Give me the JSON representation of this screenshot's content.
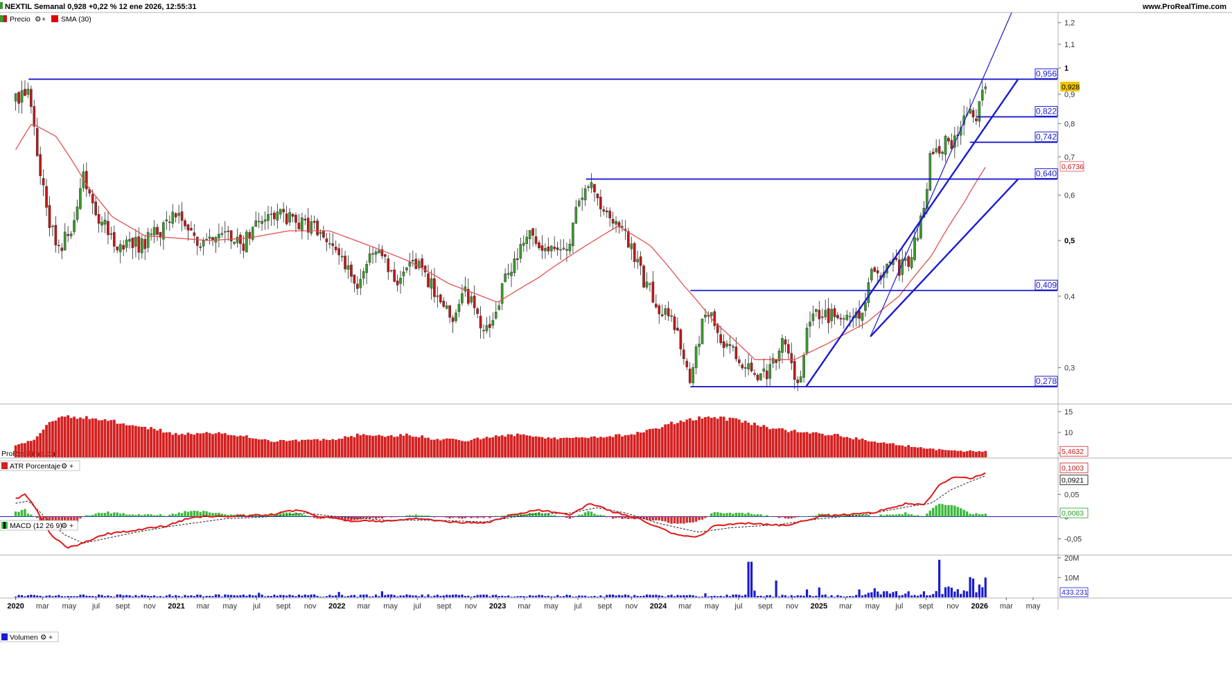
{
  "header": {
    "title": "NEXTIL Semanal 0,928 +0,22 % 12 ene 2026, 12:55:31",
    "site": "www.ProRealTime.com",
    "watermark": "ProRealTime.com"
  },
  "legends": {
    "price": "Precio",
    "sma": "SMA (30)",
    "atr": "ATR Porcentaje",
    "macd": "MACD (12 26 9)",
    "volume": "Volumen"
  },
  "colors": {
    "level_line": "#1a1ad0",
    "bull_candle": "#3c9a2e",
    "bear_candle": "#c01818",
    "sma": "#e05050",
    "atr_bar": "#d42020",
    "macd_line": "#e01818",
    "macd_hist": "#3cb83c",
    "volume_bar": "#1a1ad0",
    "current_price_bg": "#f0c400"
  },
  "chart_data": [
    {
      "type": "candlestick",
      "title": "NEXTIL Semanal",
      "y_scale": "log",
      "ylim": [
        0.26,
        1.25
      ],
      "y_ticks": [
        "0,3",
        "0,4",
        "0,5",
        "0,6",
        "0,7",
        "0,8",
        "0,9",
        "1",
        "1,1",
        "1,2"
      ],
      "x_ticks": [
        "2020",
        "mar",
        "may",
        "jul",
        "sept",
        "nov",
        "2021",
        "mar",
        "may",
        "jul",
        "sept",
        "nov",
        "2022",
        "mar",
        "may",
        "jul",
        "sept",
        "nov",
        "2023",
        "mar",
        "may",
        "jul",
        "sept",
        "nov",
        "2024",
        "mar",
        "may",
        "jul",
        "sept",
        "nov",
        "2025",
        "mar",
        "may",
        "jul",
        "sept",
        "nov",
        "2026",
        "mar",
        "may"
      ],
      "last_price": "0,928",
      "sma_last": "0,6736",
      "levels": [
        {
          "label": "0,956",
          "value": 0.956
        },
        {
          "label": "0,822",
          "value": 0.822
        },
        {
          "label": "0,742",
          "value": 0.742
        },
        {
          "label": "0,640",
          "value": 0.64
        },
        {
          "label": "0,409",
          "value": 0.409
        },
        {
          "label": "0,278",
          "value": 0.278
        }
      ],
      "close_anchors": [
        [
          2020.0,
          0.88
        ],
        [
          2020.08,
          0.9
        ],
        [
          2020.12,
          0.75
        ],
        [
          2020.2,
          0.55
        ],
        [
          2020.26,
          0.48
        ],
        [
          2020.35,
          0.52
        ],
        [
          2020.42,
          0.64
        ],
        [
          2020.5,
          0.56
        ],
        [
          2020.6,
          0.5
        ],
        [
          2020.75,
          0.49
        ],
        [
          2020.9,
          0.52
        ],
        [
          2021.0,
          0.56
        ],
        [
          2021.15,
          0.49
        ],
        [
          2021.3,
          0.52
        ],
        [
          2021.42,
          0.49
        ],
        [
          2021.5,
          0.55
        ],
        [
          2021.65,
          0.56
        ],
        [
          2021.75,
          0.54
        ],
        [
          2021.9,
          0.52
        ],
        [
          2022.0,
          0.49
        ],
        [
          2022.12,
          0.41
        ],
        [
          2022.25,
          0.49
        ],
        [
          2022.37,
          0.43
        ],
        [
          2022.45,
          0.47
        ],
        [
          2022.6,
          0.41
        ],
        [
          2022.72,
          0.37
        ],
        [
          2022.8,
          0.41
        ],
        [
          2022.92,
          0.34
        ],
        [
          2023.0,
          0.39
        ],
        [
          2023.1,
          0.46
        ],
        [
          2023.2,
          0.51
        ],
        [
          2023.32,
          0.49
        ],
        [
          2023.42,
          0.47
        ],
        [
          2023.5,
          0.57
        ],
        [
          2023.57,
          0.62
        ],
        [
          2023.68,
          0.56
        ],
        [
          2023.8,
          0.51
        ],
        [
          2023.9,
          0.43
        ],
        [
          2024.0,
          0.38
        ],
        [
          2024.1,
          0.36
        ],
        [
          2024.2,
          0.29
        ],
        [
          2024.28,
          0.36
        ],
        [
          2024.33,
          0.38
        ],
        [
          2024.4,
          0.33
        ],
        [
          2024.55,
          0.3
        ],
        [
          2024.68,
          0.29
        ],
        [
          2024.78,
          0.33
        ],
        [
          2024.88,
          0.28
        ],
        [
          2024.95,
          0.38
        ],
        [
          2025.05,
          0.37
        ],
        [
          2025.15,
          0.36
        ],
        [
          2025.25,
          0.37
        ],
        [
          2025.32,
          0.43
        ],
        [
          2025.45,
          0.45
        ],
        [
          2025.55,
          0.45
        ],
        [
          2025.62,
          0.52
        ],
        [
          2025.67,
          0.62
        ],
        [
          2025.7,
          0.72
        ],
        [
          2025.78,
          0.74
        ],
        [
          2025.85,
          0.75
        ],
        [
          2025.93,
          0.86
        ],
        [
          2025.97,
          0.78
        ],
        [
          2026.03,
          0.94
        ],
        [
          2026.04,
          0.928
        ]
      ],
      "sma_anchors": [
        [
          2020.0,
          0.72
        ],
        [
          2020.1,
          0.8
        ],
        [
          2020.25,
          0.76
        ],
        [
          2020.45,
          0.62
        ],
        [
          2020.6,
          0.55
        ],
        [
          2020.8,
          0.51
        ],
        [
          2021.0,
          0.505
        ],
        [
          2021.2,
          0.5
        ],
        [
          2021.45,
          0.505
        ],
        [
          2021.7,
          0.52
        ],
        [
          2021.95,
          0.52
        ],
        [
          2022.2,
          0.49
        ],
        [
          2022.45,
          0.46
        ],
        [
          2022.7,
          0.42
        ],
        [
          2023.0,
          0.39
        ],
        [
          2023.25,
          0.43
        ],
        [
          2023.5,
          0.48
        ],
        [
          2023.75,
          0.53
        ],
        [
          2023.95,
          0.49
        ],
        [
          2024.15,
          0.42
        ],
        [
          2024.35,
          0.36
        ],
        [
          2024.6,
          0.31
        ],
        [
          2024.85,
          0.31
        ],
        [
          2025.05,
          0.33
        ],
        [
          2025.3,
          0.36
        ],
        [
          2025.5,
          0.4
        ],
        [
          2025.7,
          0.47
        ],
        [
          2025.9,
          0.58
        ],
        [
          2026.04,
          0.6736
        ]
      ],
      "trendlines": [
        {
          "from": [
            2024.92,
            0.278
          ],
          "to": [
            2026.24,
            0.956
          ]
        },
        {
          "from": [
            2025.32,
            0.34
          ],
          "to": [
            2026.24,
            0.64
          ]
        },
        {
          "from": [
            2025.32,
            0.34
          ],
          "to": [
            2026.2,
            1.25
          ]
        }
      ]
    },
    {
      "type": "bar",
      "title": "ATR Porcentaje",
      "y_ticks": [
        "5",
        "10",
        "15"
      ],
      "ylim": [
        4,
        16
      ],
      "last_value": "5,4632",
      "anchors": [
        [
          2020.0,
          7.0
        ],
        [
          2020.12,
          8.5
        ],
        [
          2020.2,
          12.5
        ],
        [
          2020.3,
          14.0
        ],
        [
          2020.5,
          13.5
        ],
        [
          2020.7,
          12.0
        ],
        [
          2020.9,
          10.5
        ],
        [
          2021.0,
          9.5
        ],
        [
          2021.2,
          10.0
        ],
        [
          2021.45,
          9.0
        ],
        [
          2021.6,
          8.0
        ],
        [
          2021.8,
          8.0
        ],
        [
          2022.0,
          8.5
        ],
        [
          2022.15,
          9.5
        ],
        [
          2022.3,
          9.0
        ],
        [
          2022.45,
          9.5
        ],
        [
          2022.6,
          8.5
        ],
        [
          2022.8,
          8.0
        ],
        [
          2022.95,
          9.0
        ],
        [
          2023.1,
          9.5
        ],
        [
          2023.3,
          8.5
        ],
        [
          2023.5,
          9.0
        ],
        [
          2023.7,
          9.0
        ],
        [
          2023.9,
          10.0
        ],
        [
          2024.0,
          11.0
        ],
        [
          2024.15,
          13.0
        ],
        [
          2024.25,
          13.5
        ],
        [
          2024.4,
          13.5
        ],
        [
          2024.55,
          12.5
        ],
        [
          2024.7,
          11.0
        ],
        [
          2024.9,
          10.0
        ],
        [
          2025.1,
          9.5
        ],
        [
          2025.3,
          8.0
        ],
        [
          2025.5,
          7.0
        ],
        [
          2025.7,
          6.0
        ],
        [
          2025.85,
          5.5
        ],
        [
          2026.04,
          5.4632
        ]
      ]
    },
    {
      "type": "line",
      "title": "MACD (12 26 9)",
      "y_ticks": [
        "-0,05",
        "0",
        "0,05"
      ],
      "ylim": [
        -0.085,
        0.13
      ],
      "macd_last": "0,1003",
      "signal_last": "0,0921",
      "histogram_last": "0,0083",
      "macd_anchors": [
        [
          2020.0,
          0.04
        ],
        [
          2020.06,
          0.05
        ],
        [
          2020.12,
          0.02
        ],
        [
          2020.22,
          -0.04
        ],
        [
          2020.32,
          -0.07
        ],
        [
          2020.42,
          -0.06
        ],
        [
          2020.55,
          -0.04
        ],
        [
          2020.75,
          -0.03
        ],
        [
          2020.95,
          -0.02
        ],
        [
          2021.1,
          0.0
        ],
        [
          2021.35,
          0.0
        ],
        [
          2021.6,
          0.005
        ],
        [
          2021.75,
          0.015
        ],
        [
          2021.9,
          0.0
        ],
        [
          2022.1,
          -0.01
        ],
        [
          2022.3,
          -0.01
        ],
        [
          2022.5,
          -0.005
        ],
        [
          2022.7,
          -0.012
        ],
        [
          2022.92,
          -0.015
        ],
        [
          2023.05,
          0.0
        ],
        [
          2023.25,
          0.015
        ],
        [
          2023.45,
          0.005
        ],
        [
          2023.58,
          0.03
        ],
        [
          2023.72,
          0.01
        ],
        [
          2023.88,
          -0.005
        ],
        [
          2024.1,
          -0.04
        ],
        [
          2024.25,
          -0.045
        ],
        [
          2024.35,
          -0.02
        ],
        [
          2024.55,
          -0.015
        ],
        [
          2024.8,
          -0.02
        ],
        [
          2025.0,
          0.0
        ],
        [
          2025.2,
          0.005
        ],
        [
          2025.35,
          0.01
        ],
        [
          2025.55,
          0.03
        ],
        [
          2025.65,
          0.025
        ],
        [
          2025.75,
          0.07
        ],
        [
          2025.85,
          0.09
        ],
        [
          2025.95,
          0.085
        ],
        [
          2026.04,
          0.1003
        ]
      ],
      "signal_anchors": [
        [
          2020.0,
          0.03
        ],
        [
          2020.08,
          0.035
        ],
        [
          2020.18,
          0.0
        ],
        [
          2020.3,
          -0.04
        ],
        [
          2020.42,
          -0.06
        ],
        [
          2020.55,
          -0.05
        ],
        [
          2020.75,
          -0.035
        ],
        [
          2021.0,
          -0.02
        ],
        [
          2021.3,
          -0.005
        ],
        [
          2021.6,
          0.0
        ],
        [
          2021.8,
          0.008
        ],
        [
          2022.0,
          0.0
        ],
        [
          2022.3,
          -0.008
        ],
        [
          2022.6,
          -0.008
        ],
        [
          2022.92,
          -0.012
        ],
        [
          2023.2,
          0.005
        ],
        [
          2023.45,
          0.008
        ],
        [
          2023.62,
          0.02
        ],
        [
          2023.8,
          0.008
        ],
        [
          2024.0,
          -0.015
        ],
        [
          2024.25,
          -0.035
        ],
        [
          2024.45,
          -0.025
        ],
        [
          2024.75,
          -0.018
        ],
        [
          2025.0,
          -0.005
        ],
        [
          2025.3,
          0.005
        ],
        [
          2025.55,
          0.022
        ],
        [
          2025.7,
          0.03
        ],
        [
          2025.82,
          0.06
        ],
        [
          2025.95,
          0.08
        ],
        [
          2026.04,
          0.0921
        ]
      ]
    },
    {
      "type": "bar",
      "title": "Volumen",
      "y_ticks": [
        "10M",
        "20M"
      ],
      "ylim": [
        0,
        21
      ],
      "last_value": "433.231",
      "spikes": [
        [
          2024.57,
          18.0
        ],
        [
          2024.73,
          8.5
        ],
        [
          2024.92,
          4.0
        ],
        [
          2025.0,
          5.0
        ],
        [
          2025.25,
          4.0
        ],
        [
          2025.75,
          19.0
        ],
        [
          2025.8,
          5.5
        ],
        [
          2025.95,
          9.5
        ],
        [
          2026.0,
          6.5
        ],
        [
          2026.03,
          10.0
        ]
      ]
    }
  ]
}
